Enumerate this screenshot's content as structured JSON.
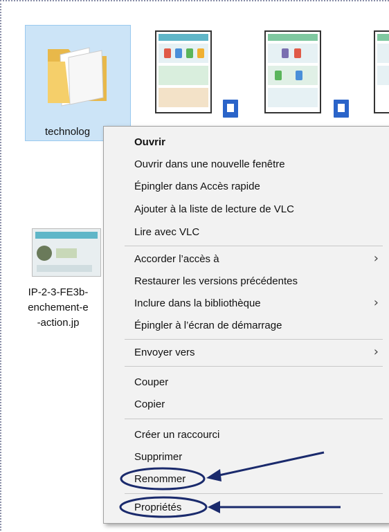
{
  "explorer": {
    "folder_label": "technolog",
    "image_label_lines": [
      "IP-2-3-FE3b-",
      "enchement-e",
      "-action.jp"
    ]
  },
  "context_menu": {
    "items": [
      {
        "label": "Ouvrir",
        "bold": true
      },
      {
        "label": "Ouvrir dans une nouvelle fenêtre"
      },
      {
        "label": "Épingler dans Accès rapide"
      },
      {
        "label": "Ajouter à la liste de lecture de VLC"
      },
      {
        "label": "Lire avec VLC"
      },
      {
        "label": "Accorder l’accès à",
        "submenu": true
      },
      {
        "label": "Restaurer les versions précédentes"
      },
      {
        "label": "Inclure dans la bibliothèque",
        "submenu": true
      },
      {
        "label": "Épingler à l’écran de démarrage"
      },
      {
        "label": "Envoyer vers",
        "submenu": true
      },
      {
        "label": "Couper"
      },
      {
        "label": "Copier"
      },
      {
        "label": "Créer un raccourci"
      },
      {
        "label": "Supprimer"
      },
      {
        "label": "Renommer"
      },
      {
        "label": "Propriétés"
      }
    ],
    "submenu_glyph": "›"
  },
  "annotations": {
    "color": "#1a2a6c",
    "highlighted": [
      "Renommer",
      "Propriétés"
    ]
  }
}
